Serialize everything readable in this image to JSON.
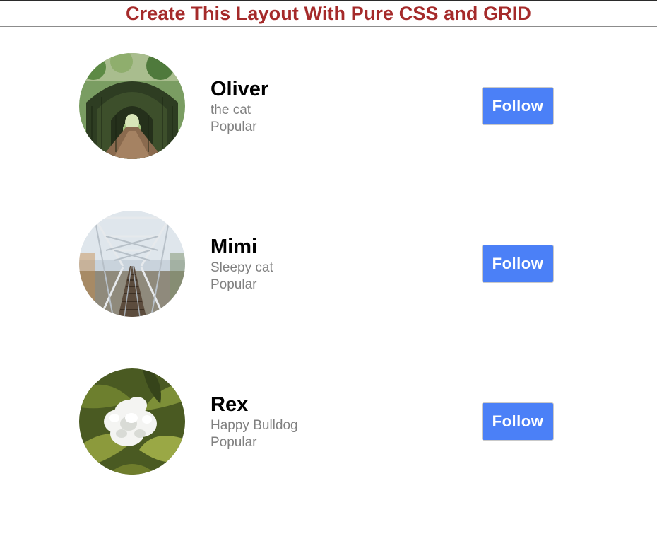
{
  "header": {
    "title": "Create This Layout With Pure CSS and GRID"
  },
  "colors": {
    "title": "#a52a2a",
    "button": "#4b80f7",
    "subtext": "#808080"
  },
  "cards": [
    {
      "name": "Oliver",
      "description": "the cat",
      "tag": "Popular",
      "button_label": "Follow",
      "avatar_image": "green tunnel path"
    },
    {
      "name": "Mimi",
      "description": "Sleepy cat",
      "tag": "Popular",
      "button_label": "Follow",
      "avatar_image": "steel railway bridge"
    },
    {
      "name": "Rex",
      "description": "Happy Bulldog",
      "tag": "Popular",
      "button_label": "Follow",
      "avatar_image": "white flower"
    }
  ]
}
